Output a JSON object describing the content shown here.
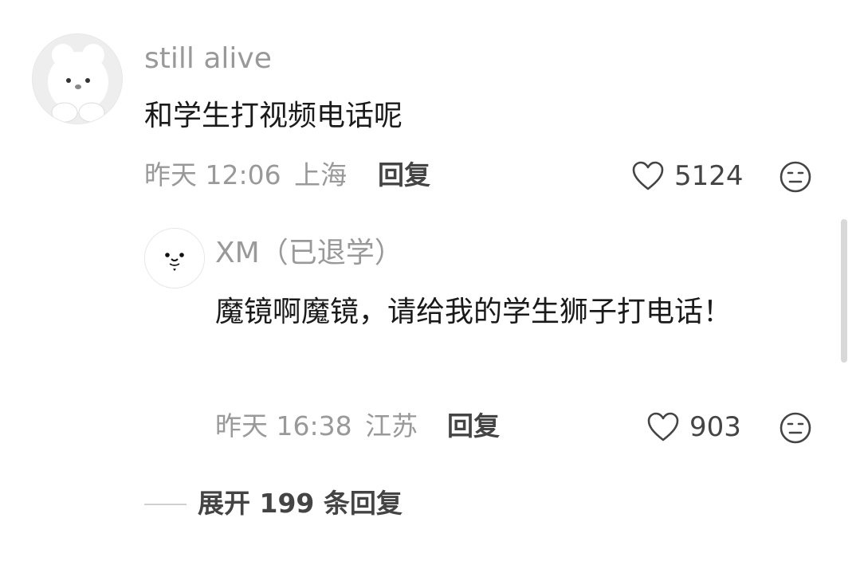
{
  "comment": {
    "username": "still alive",
    "text": "和学生打视频电话呢",
    "time": "昨天 12:06",
    "location": "上海",
    "reply_label": "回复",
    "likes": "5124"
  },
  "reply": {
    "username": "XM（已退学）",
    "text": "魔镜啊魔镜，请给我的学生狮子打电话！",
    "time": "昨天 16:38",
    "location": "江苏",
    "reply_label": "回复",
    "likes": "903"
  },
  "expand_label": "展开 199 条回复",
  "icons": {
    "like": "heart-outline-icon",
    "dislike": "neutral-face-icon"
  },
  "colors": {
    "text": "#1a1a1a",
    "muted": "#999999",
    "icon": "#444444"
  }
}
